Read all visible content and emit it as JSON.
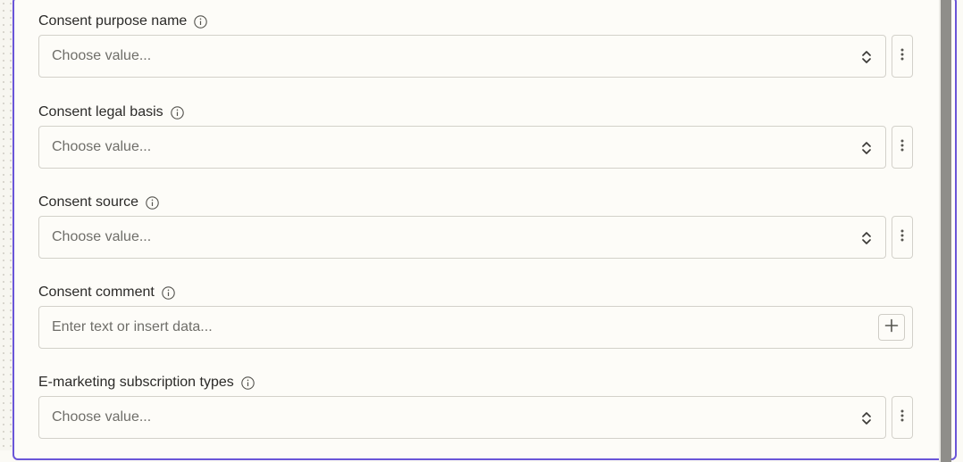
{
  "form": {
    "fields": [
      {
        "label": "Consent purpose name",
        "type": "select",
        "placeholder": "Choose value..."
      },
      {
        "label": "Consent legal basis",
        "type": "select",
        "placeholder": "Choose value..."
      },
      {
        "label": "Consent source",
        "type": "select",
        "placeholder": "Choose value..."
      },
      {
        "label": "Consent comment",
        "type": "text",
        "placeholder": "Enter text or insert data..."
      },
      {
        "label": "E-marketing subscription types",
        "type": "select",
        "placeholder": "Choose value..."
      }
    ]
  },
  "icons": {
    "info": "info-icon",
    "select": "chevron-up-down-icon",
    "more": "more-vertical-icon",
    "insert": "plus-icon"
  },
  "colors": {
    "accent_border": "#6a55d8",
    "background": "#fdfcf8",
    "input_border": "#d3d1ca",
    "placeholder": "#6f6e69"
  }
}
